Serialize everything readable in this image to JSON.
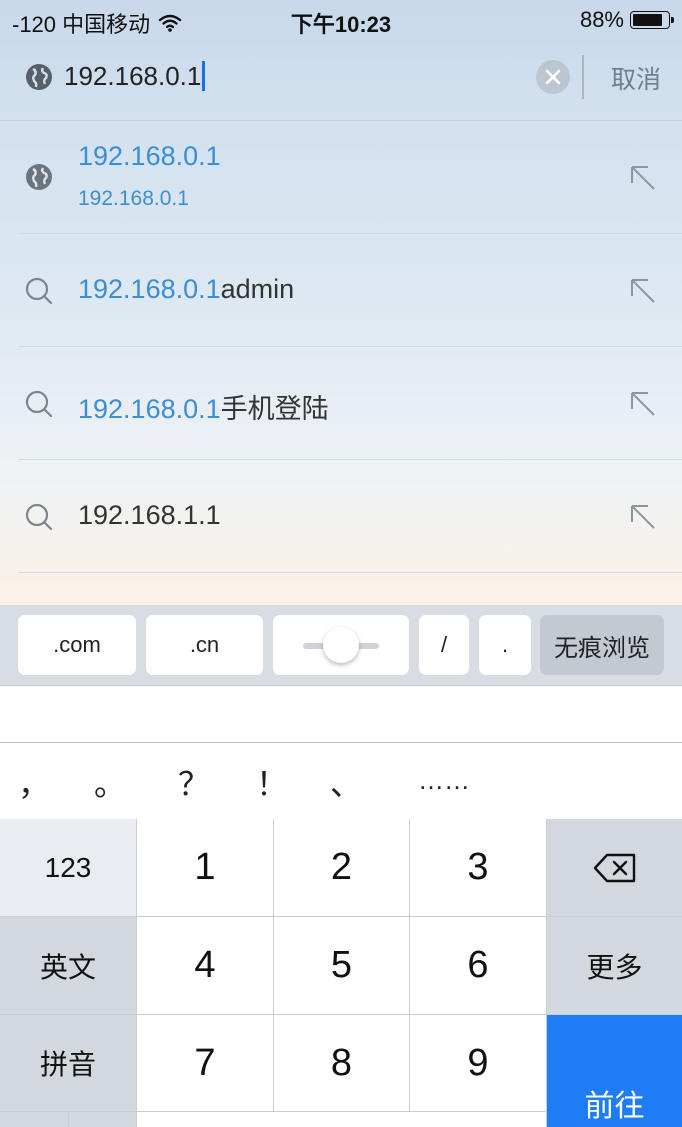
{
  "status_bar": {
    "carrier": "-120 中国移动",
    "time": "下午10:23",
    "battery_text": "88%",
    "battery_level": 0.88
  },
  "search": {
    "value": "192.168.0.1",
    "cancel_label": "取消"
  },
  "suggestions": [
    {
      "icon": "globe-icon",
      "highlight": "192.168.0.1",
      "rest": "",
      "subtitle": "192.168.0.1"
    },
    {
      "icon": "search-icon",
      "highlight": "192.168.0.1",
      "rest": "admin"
    },
    {
      "icon": "search-icon",
      "highlight": "192.168.0.1",
      "rest": "手机登陆"
    },
    {
      "icon": "search-icon",
      "highlight": "",
      "rest": "192.168.1.1"
    }
  ],
  "quick_bar": {
    "com": ".com",
    "cn": ".cn",
    "slash": "/",
    "dot": ".",
    "private": "无痕浏览"
  },
  "punctuation": [
    "，",
    "。",
    "？",
    "！",
    "、",
    "……"
  ],
  "keyboard": {
    "k123": "123",
    "k1": "1",
    "k2": "2",
    "k3": "3",
    "k4": "4",
    "k5": "5",
    "k6": "6",
    "k7": "7",
    "k8": "8",
    "k9": "9",
    "english": "英文",
    "more": "更多",
    "pinyin": "拼音",
    "go": "前往"
  },
  "colors": {
    "accent": "#3a8ed6",
    "go_key": "#1e7cf5"
  }
}
